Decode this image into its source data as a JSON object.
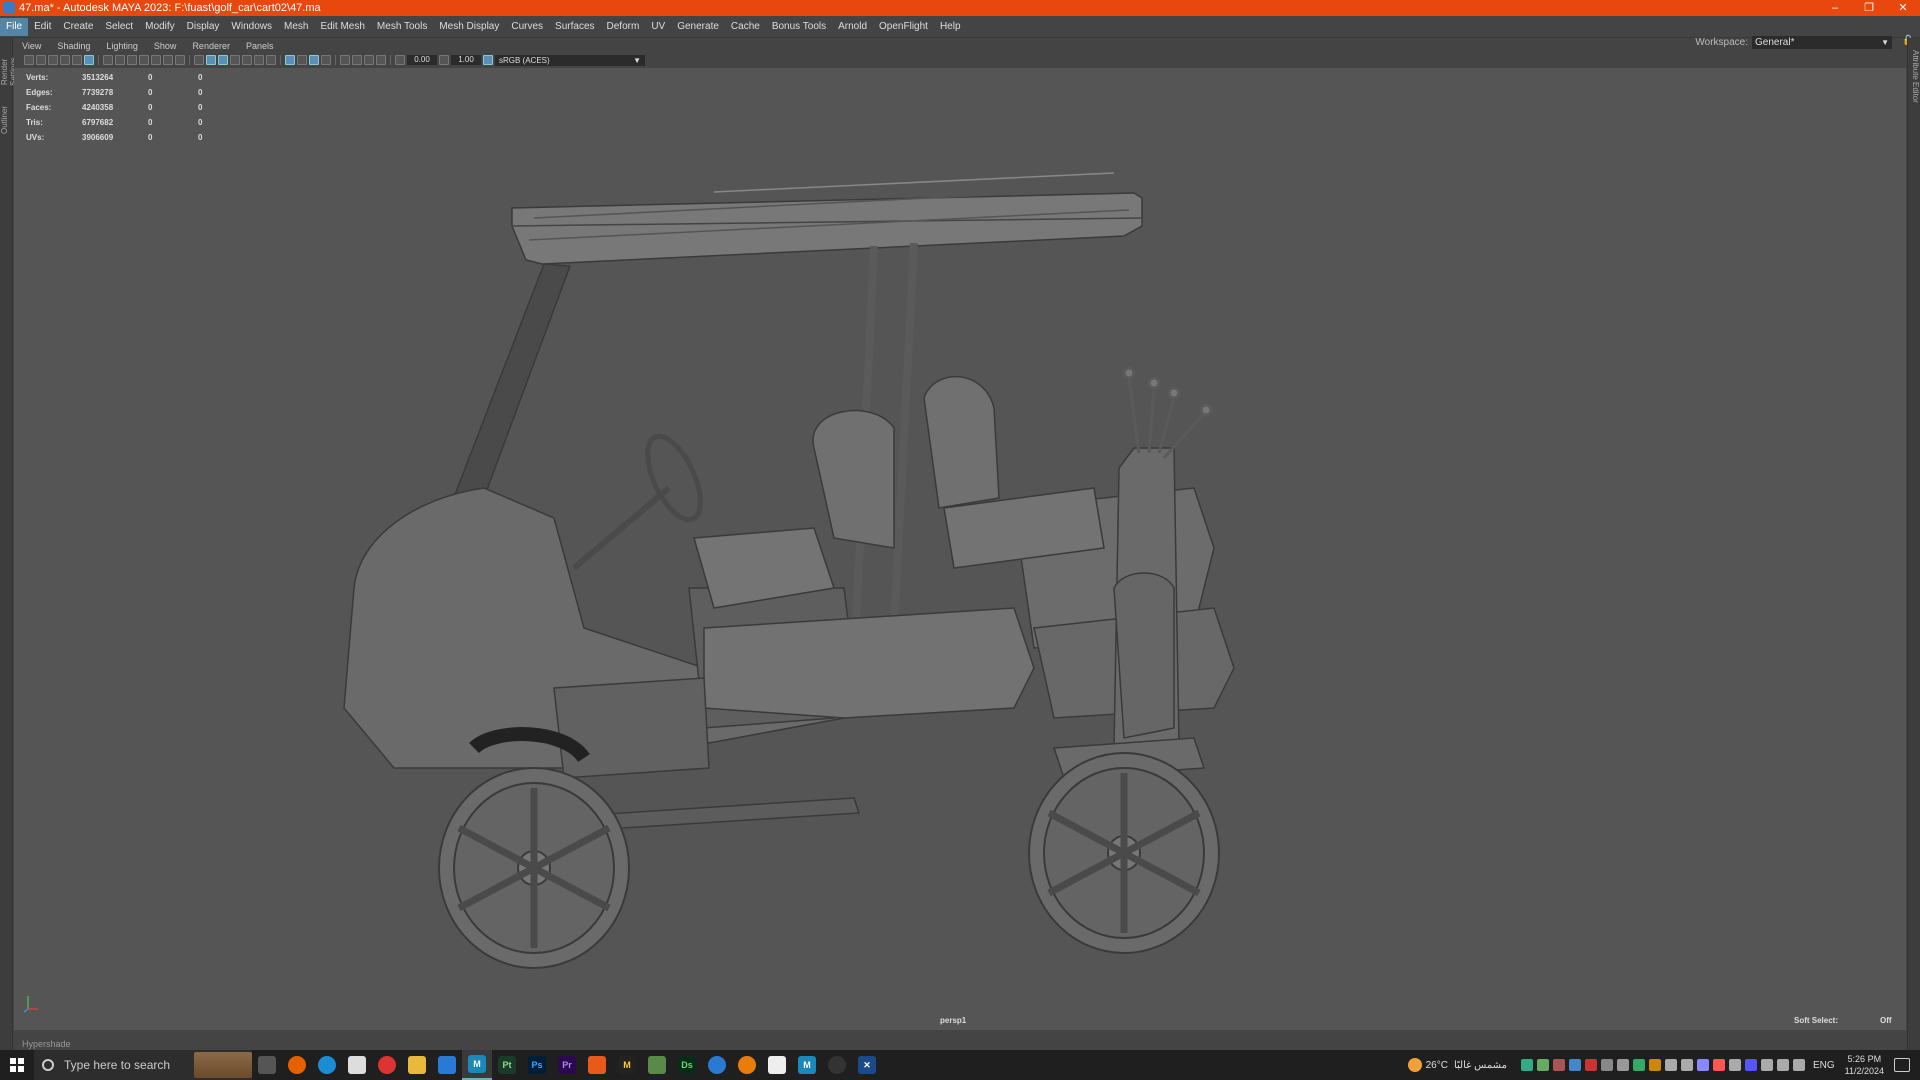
{
  "window": {
    "title": "47.ma* - Autodesk MAYA 2023: F:\\fuast\\golf_car\\cart02\\47.ma",
    "controls": [
      "–",
      "❐",
      "✕"
    ]
  },
  "menu": {
    "items": [
      "File",
      "Edit",
      "Create",
      "Select",
      "Modify",
      "Display",
      "Windows",
      "Mesh",
      "Edit Mesh",
      "Mesh Tools",
      "Mesh Display",
      "Curves",
      "Surfaces",
      "Deform",
      "UV",
      "Generate",
      "Cache",
      "Bonus Tools",
      "Arnold",
      "OpenFlight",
      "Help"
    ],
    "active_index": 0
  },
  "workspace": {
    "label": "Workspace:",
    "value": "General*"
  },
  "side_tabs": {
    "left": [
      "Render Settings",
      "Outliner"
    ],
    "right": [
      "Attribute Editor"
    ]
  },
  "panel_menu": [
    "View",
    "Shading",
    "Lighting",
    "Show",
    "Renderer",
    "Panels"
  ],
  "panel_toolbar": {
    "exposure": "0.00",
    "gamma": "1.00",
    "color_space": "sRGB (ACES)"
  },
  "hud": {
    "rows": [
      {
        "label": "Verts:",
        "value": "3513264",
        "sel": "0",
        "comp": "0"
      },
      {
        "label": "Edges:",
        "value": "7739278",
        "sel": "0",
        "comp": "0"
      },
      {
        "label": "Faces:",
        "value": "4240358",
        "sel": "0",
        "comp": "0"
      },
      {
        "label": "Tris:",
        "value": "6797682",
        "sel": "0",
        "comp": "0"
      },
      {
        "label": "UVs:",
        "value": "3906609",
        "sel": "0",
        "comp": "0"
      }
    ]
  },
  "viewport": {
    "camera": "persp1",
    "soft_select_label": "Soft Select:",
    "soft_select_value": "Off"
  },
  "hypershade": "Hypershade",
  "taskbar": {
    "search_placeholder": "Type here to search",
    "apps": [
      {
        "name": "Pt",
        "color": "#1a3a2a"
      },
      {
        "name": "Ps",
        "color": "#001e36"
      },
      {
        "name": "Pr",
        "color": "#2a0a4a"
      },
      {
        "name": "M",
        "color": "#0a3a5a"
      },
      {
        "name": "Ds",
        "color": "#0a2a1a"
      }
    ],
    "weather_temp": "26°C",
    "weather_text": "مشمس غالبًا",
    "language": "ENG",
    "time": "5:26 PM",
    "date": "11/2/2024"
  },
  "colors": {
    "title_bar": "#e8470e",
    "menu_active": "#5285a6",
    "viewport_bg": "#555555"
  }
}
